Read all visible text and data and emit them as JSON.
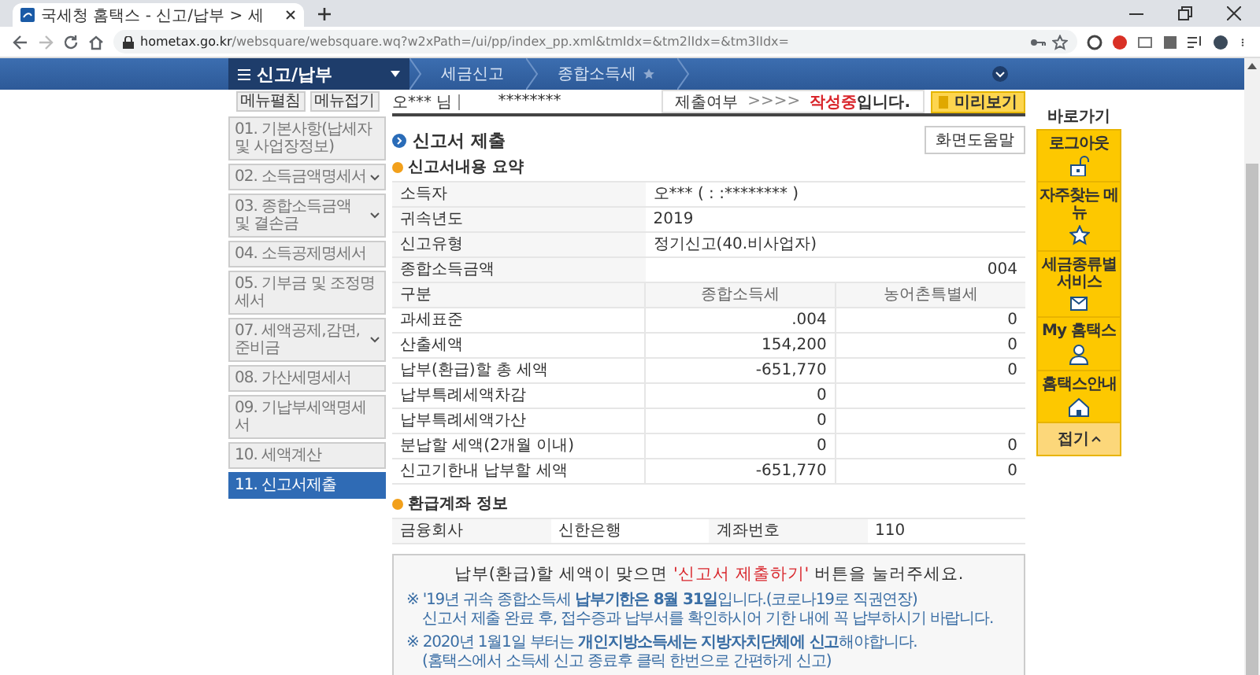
{
  "browser": {
    "tab_title": "국세청 홈택스 - 신고/납부 > 세",
    "url_host": "hometax.go.kr",
    "url_path": "/websquare/websquare.wq?w2xPath=/ui/pp/index_pp.xml&tmIdx=&tm2lIdx=&tm3lIdx="
  },
  "nav": {
    "menu_title": "신고/납부",
    "breadcrumbs": [
      "세금신고",
      "종합소득세"
    ]
  },
  "sidebar": {
    "buttons": [
      "메뉴펼침",
      "메뉴접기"
    ],
    "items": [
      {
        "label": "01. 기본사항(납세자 및 사업장정보)",
        "selected": false,
        "has_submenu": false
      },
      {
        "label": "02. 소득금액명세서",
        "selected": false,
        "has_submenu": true
      },
      {
        "label": "03. 종합소득금액 및 결손금",
        "selected": false,
        "has_submenu": true
      },
      {
        "label": "04. 소득공제명세서",
        "selected": false,
        "has_submenu": false
      },
      {
        "label": "05. 기부금 및 조정명세서",
        "selected": false,
        "has_submenu": false
      },
      {
        "label": "07. 세액공제,감면,준비금",
        "selected": false,
        "has_submenu": true
      },
      {
        "label": "08. 가산세명세서",
        "selected": false,
        "has_submenu": false
      },
      {
        "label": "09. 기납부세액명세서",
        "selected": false,
        "has_submenu": false
      },
      {
        "label": "10. 세액계산",
        "selected": false,
        "has_submenu": false
      },
      {
        "label": "11. 신고서제출",
        "selected": true,
        "has_submenu": false
      }
    ]
  },
  "user_bar": {
    "user": "오*** 님",
    "user_id": "********",
    "status_label": "제출여부",
    "status_arrows": ">>>>",
    "status_value": "작성중",
    "status_suffix": "입니다.",
    "preview_button": "미리보기"
  },
  "section": {
    "title": "신고서 제출",
    "help_button": "화면도움말",
    "summary_title": "신고서내용 요약"
  },
  "summary": [
    {
      "label": "소득자",
      "value": "오*** (  :         :******** )"
    },
    {
      "label": "귀속년도",
      "value": "2019"
    },
    {
      "label": "신고유형",
      "value": "정기신고(40.비사업자)"
    },
    {
      "label": "종합소득금액",
      "value": "004"
    }
  ],
  "tax_table": {
    "columns": [
      "구분",
      "종합소득세",
      "농어촌특별세"
    ],
    "rows": [
      {
        "label": "과세표준",
        "income_tax": ".004",
        "rural_tax": "0"
      },
      {
        "label": "산출세액",
        "income_tax": "154,200",
        "rural_tax": "0"
      },
      {
        "label": "납부(환급)할 총 세액",
        "income_tax": "-651,770",
        "rural_tax": "0"
      },
      {
        "label": "납부특례세액차감",
        "income_tax": "0"
      },
      {
        "label": "납부특례세액가산",
        "income_tax": "0"
      },
      {
        "label": "분납할 세액(2개월 이내)",
        "income_tax": "0",
        "rural_tax": "0"
      },
      {
        "label": "신고기한내 납부할 세액",
        "income_tax": "-651,770",
        "rural_tax": "0"
      }
    ]
  },
  "refund": {
    "title": "환급계좌 정보",
    "fields": [
      {
        "label": "금융회사",
        "value": "신한은행"
      },
      {
        "label": "계좌번호",
        "value": "110"
      }
    ]
  },
  "notice": {
    "headline_before": "납부(환급)할 세액이 맞으면 ",
    "headline_highlight": "'신고서 제출하기'",
    "headline_after": " 버튼을 눌러주세요.",
    "notes": [
      [
        "※ '19년 귀속 종합소득세 **납부기한은 8월 31일**입니다.(코로나19로 직권연장)",
        "신고서 제출 완료 후, 접수증과 납부서를 확인하시어 기한 내에 꼭 납부하시기 바랍니다."
      ],
      [
        "※ 2020년 1월1일 부터는 **개인지방소득세는 지방자치단체에 신고**해야합니다.",
        "(홈택스에서 소득세 신고 종료후 클릭 한번으로 간편하게 신고)"
      ]
    ]
  },
  "quick_bar": {
    "title": "바로가기",
    "items": [
      {
        "label": "로그아웃",
        "kind": "lock"
      },
      {
        "label": "자주찾는 메뉴",
        "kind": "star"
      },
      {
        "label": "세금종류별 서비스",
        "kind": "envelope"
      },
      {
        "label": "My 홈택스",
        "kind": "person"
      },
      {
        "label": "홈택스안내",
        "kind": "house"
      }
    ],
    "fold_button": "접기"
  }
}
